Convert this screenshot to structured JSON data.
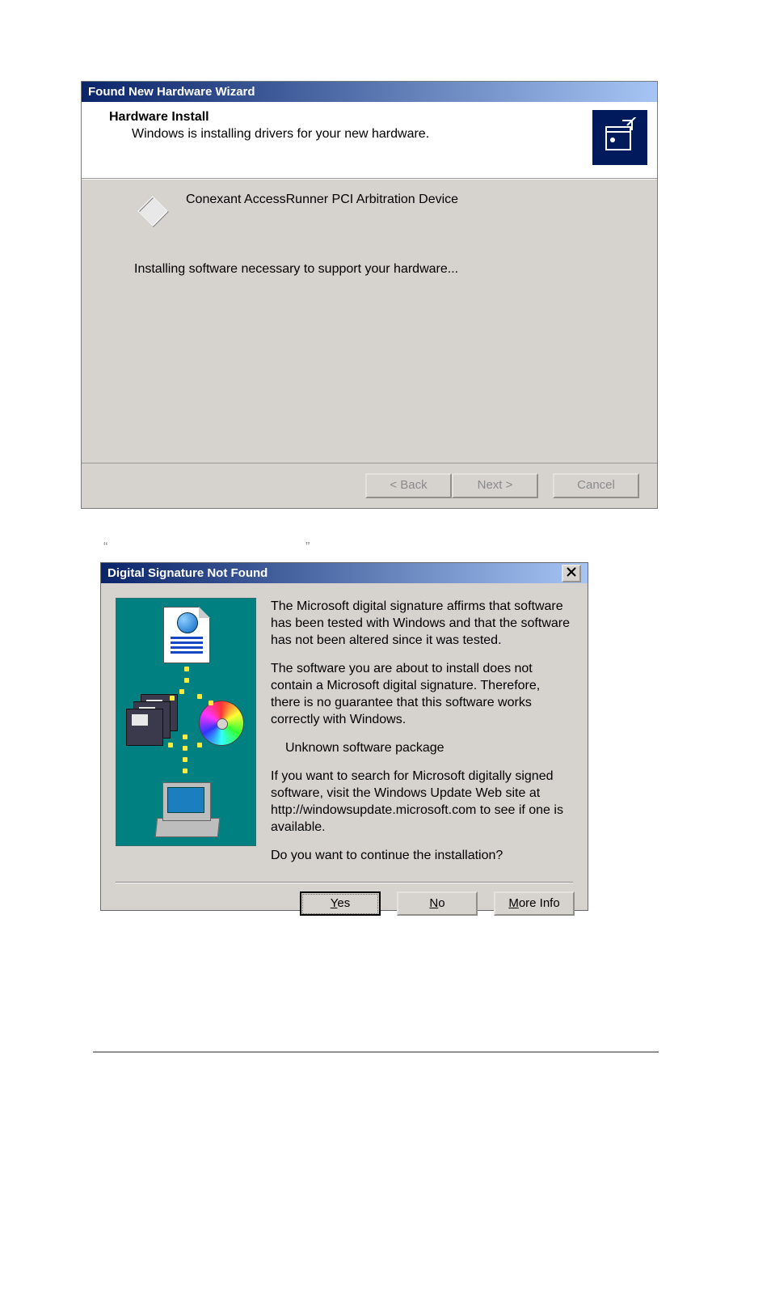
{
  "wizard": {
    "title": "Found New Hardware Wizard",
    "header_title": "Hardware Install",
    "header_sub": "Windows is installing drivers for your new hardware.",
    "device_name": "Conexant AccessRunner PCI Arbitration Device",
    "status": "Installing software necessary to support your hardware...",
    "buttons": {
      "back": "< Back",
      "next": "Next >",
      "cancel": "Cancel"
    }
  },
  "intertext": {
    "quote_open": "“",
    "quote_close": "”"
  },
  "sig": {
    "title": "Digital Signature Not Found",
    "p1": "The Microsoft digital signature affirms that software has been tested with Windows and that the software has not been altered since it was tested.",
    "p2": "The software you are about to install does not contain a Microsoft digital signature. Therefore,  there is no guarantee that this software works correctly with Windows.",
    "pkg": "Unknown software package",
    "p3": "If you want to search for Microsoft digitally signed software, visit the Windows Update Web site at http://windowsupdate.microsoft.com to see if one is available.",
    "p4": "Do you want to continue the installation?",
    "buttons": {
      "yes": "Yes",
      "no": "No",
      "more": "More Info"
    }
  }
}
